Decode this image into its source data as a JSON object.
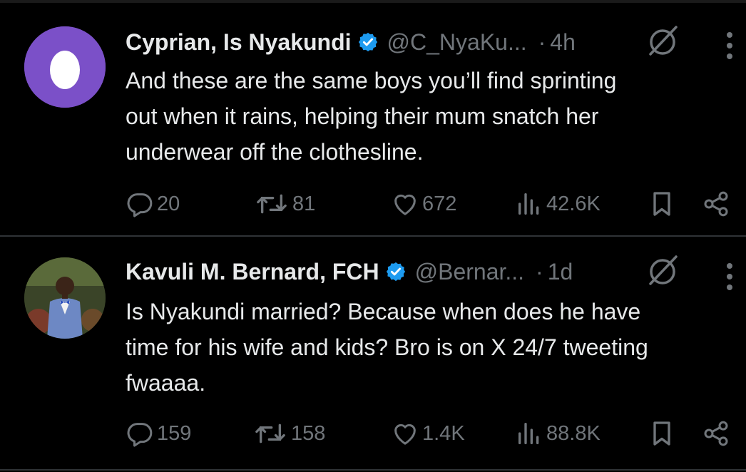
{
  "tweets": [
    {
      "display_name": "Cyprian, Is Nyakundi",
      "handle": "@C_NyaKu...",
      "dot": "·",
      "time": "4h",
      "text": "And these are the same boys you’ll find sprinting\nout when it rains, helping their mum snatch her\nunderwear off the clothesline.",
      "replies": "20",
      "reposts": "81",
      "likes": "672",
      "views": "42.6K"
    },
    {
      "display_name": "Kavuli M. Bernard, FCH",
      "handle": "@Bernar...",
      "dot": "·",
      "time": "1d",
      "text": "Is Nyakundi married? Because when does he have\ntime for his wife and kids? Bro is on X 24/7 tweeting\nfwaaaa.",
      "replies": "159",
      "reposts": "158",
      "likes": "1.4K",
      "views": "88.8K"
    }
  ],
  "colors": {
    "background": "#000000",
    "text": "#e7e9ea",
    "muted": "#71767b",
    "verified": "#1d9bf0",
    "divider": "#2f3336",
    "egg_avatar": "#7b50c8"
  }
}
